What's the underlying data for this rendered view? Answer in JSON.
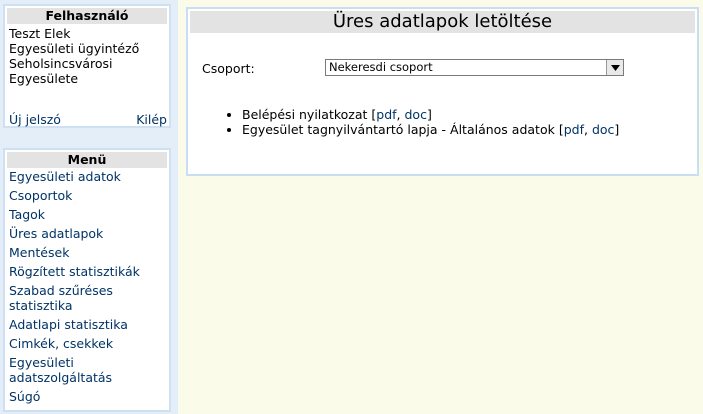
{
  "user_panel": {
    "title": "Felhasználó",
    "name": "Teszt Elek",
    "role": "Egyesületi ügyintéző",
    "org_line1": "Seholsincsvárosi",
    "org_line2": "Egyesülete",
    "new_password": "Új jelszó",
    "logout": "Kilép"
  },
  "menu": {
    "title": "Menü",
    "items": [
      {
        "label": "Egyesületi adatok"
      },
      {
        "label": "Csoportok"
      },
      {
        "label": "Tagok"
      },
      {
        "label": "Üres adatlapok"
      },
      {
        "label": "Mentések"
      },
      {
        "label": "Rögzített statisztikák"
      },
      {
        "label": "Szabad szűréses statisztika"
      },
      {
        "label": "Adatlapi statisztika"
      },
      {
        "label": "Cimkék, csekkek"
      },
      {
        "label": "Egyesületi adatszolgáltatás"
      },
      {
        "label": "Súgó"
      }
    ]
  },
  "main": {
    "title": "Üres adatlapok letöltése",
    "group_label": "Csoport:",
    "group_selected": "Nekeresdi csoport",
    "documents": [
      {
        "name": "Belépési nyilatkozat",
        "pdf": "pdf",
        "doc": "doc"
      },
      {
        "name": "Egyesület tagnyilvántartó lapja - Általános adatok",
        "pdf": "pdf",
        "doc": "doc"
      }
    ]
  }
}
